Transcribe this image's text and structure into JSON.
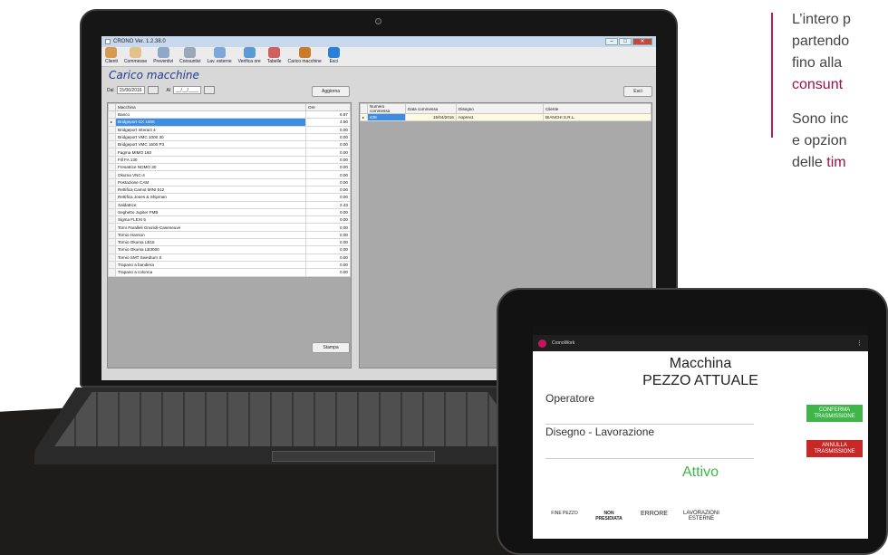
{
  "laptop": {
    "window_title": "CRONO Ver. 1.2.38.0",
    "window_controls": [
      "–",
      "□",
      "✕"
    ],
    "toolbar": [
      {
        "label": "Clienti",
        "color": "#d89a50"
      },
      {
        "label": "Commesse",
        "color": "#e2c28a"
      },
      {
        "label": "Preventivi",
        "color": "#8fa7c9"
      },
      {
        "label": "Consuntivi",
        "color": "#9aa9b5"
      },
      {
        "label": "Lav. esterne",
        "color": "#7fa7d8"
      },
      {
        "label": "Verifica ore",
        "color": "#5c9ad6"
      },
      {
        "label": "Tabelle",
        "color": "#d06060"
      },
      {
        "label": "Carico macchine",
        "color": "#c97a2a"
      },
      {
        "label": "Esci",
        "color": "#2b7fd6"
      }
    ],
    "page_title": "Carico macchine",
    "filter": {
      "from_label": "Dal",
      "from_value": "15/06/2016",
      "to_label": "Al",
      "to_value": "__/__/____"
    },
    "aggiorna_label": "Aggiorna",
    "esci_label": "Esci",
    "stampa_label": "Stampa",
    "machines": {
      "headers": [
        "Macchina",
        "Ore"
      ],
      "rows": [
        {
          "name": "Banco",
          "ore": "6.87"
        },
        {
          "name": "Bridgeport GX 1600",
          "ore": "4.50"
        },
        {
          "name": "Bridgeport Interact 4",
          "ore": "0.00"
        },
        {
          "name": "Bridgeport VMC 1000 30",
          "ore": "0.00"
        },
        {
          "name": "Bridgeport VMC 1500 P3",
          "ore": "0.00"
        },
        {
          "name": "Fagma MIMO 160",
          "ore": "0.00"
        },
        {
          "name": "Fill FA 130",
          "ore": "0.00"
        },
        {
          "name": "Fresatrice NOMO 30",
          "ore": "0.00"
        },
        {
          "name": "Okuma VNC-4",
          "ore": "0.00"
        },
        {
          "name": "Postazione CAM",
          "ore": "0.00"
        },
        {
          "name": "Rettifica Camut MINI 512",
          "ore": "0.00"
        },
        {
          "name": "Rettifica Jones & Shipman",
          "ore": "0.00"
        },
        {
          "name": "Saldatrice",
          "ore": "2.43"
        },
        {
          "name": "Seghetto Jupiter FMB",
          "ore": "0.00"
        },
        {
          "name": "Sigma FLEXI 5",
          "ore": "0.00"
        },
        {
          "name": "Torni Paralleli Grazioli-Caseneuve",
          "ore": "0.00"
        },
        {
          "name": "Tornio Hanson",
          "ore": "0.00"
        },
        {
          "name": "Tornio Okuma LB15",
          "ore": "0.00"
        },
        {
          "name": "Tornio Okuma LB3000",
          "ore": "0.00"
        },
        {
          "name": "Tornio SMT Swedturn S",
          "ore": "0.00"
        },
        {
          "name": "Trapano a bandiera",
          "ore": "0.00"
        },
        {
          "name": "Trapano a colonna",
          "ore": "0.00"
        }
      ],
      "selected_index": 1
    },
    "orders": {
      "headers": [
        "Numero commessa",
        "Data commessa",
        "Disegno",
        "Cliente"
      ],
      "rows": [
        {
          "numero": "439",
          "data": "15/04/2016",
          "disegno": "noprev1",
          "cliente": "BIANCHI S.R.L."
        }
      ]
    }
  },
  "tablet": {
    "app_name": "CronoWork",
    "menu_icon": "⋮",
    "title_line1": "Macchina",
    "title_line2": "PEZZO ATTUALE",
    "operatore_label": "Operatore",
    "disegno_label": "Disegno - Lavorazione",
    "conferma_label": "CONFERMA TRASMISSIONE",
    "annulla_label": "ANNULLA TRASMISSIONE",
    "status_label": "Attivo",
    "status_color": "#3fb54a",
    "options": [
      "FINE PEZZO",
      "NON PRESIDIATA",
      "ERRORE",
      "LAVORAZIONI ESTERNE"
    ]
  },
  "side_text": {
    "line1": "L’intero p",
    "line2": "partendo",
    "line3": "fino alla",
    "line4": "consunt",
    "line5": "Sono inc",
    "line6": "e opzion",
    "line7_prefix": "delle ",
    "line7_hl": "tim",
    "accent_color": "#9b1149"
  }
}
